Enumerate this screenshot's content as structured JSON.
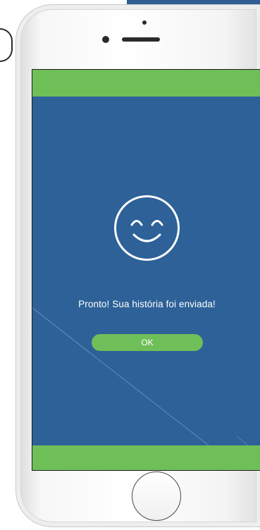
{
  "screen": {
    "message": "Pronto! Sua história foi enviada!",
    "ok_label": "OK"
  },
  "colors": {
    "screen_background": "#2d6198",
    "accent_green": "#6fbf59",
    "text": "#ffffff"
  },
  "icons": {
    "status": "smiley-face-icon"
  }
}
